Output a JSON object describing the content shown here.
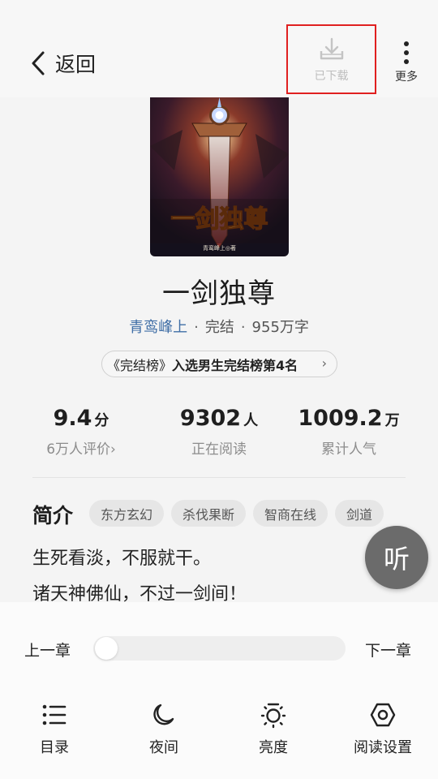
{
  "header": {
    "back_label": "返回",
    "download_label": "已下载",
    "more_label": "更多"
  },
  "book": {
    "cover_title": "一剑独尊",
    "cover_author": "青鸾峰上◎著",
    "title": "一剑独尊",
    "author": "青鸾峰上",
    "status": "完结",
    "word_count": "955万字",
    "rank_tag": "《完结榜》",
    "rank_text": "入选男生完结榜第4名",
    "rank_arrow": "›"
  },
  "stats": [
    {
      "value": "9.4",
      "unit": "分",
      "label": "6万人评价›"
    },
    {
      "value": "9302",
      "unit": "人",
      "label": "正在阅读"
    },
    {
      "value": "1009.2",
      "unit": "万",
      "label": "累计人气"
    }
  ],
  "intro": {
    "heading": "简介",
    "tags": [
      "东方玄幻",
      "杀伐果断",
      "智商在线",
      "剑道"
    ],
    "lines": [
      "生死看淡，不服就干。",
      "诸天神佛仙，不过一剑间！"
    ]
  },
  "listen_label": "听",
  "reader_panel": {
    "prev_chapter": "上一章",
    "next_chapter": "下一章",
    "progress": 0,
    "tools": [
      {
        "label": "目录",
        "icon": "list-icon"
      },
      {
        "label": "夜间",
        "icon": "moon-icon"
      },
      {
        "label": "亮度",
        "icon": "brightness-icon"
      },
      {
        "label": "阅读设置",
        "icon": "settings-hexagon-icon"
      }
    ]
  },
  "colors": {
    "highlight_border": "#e02020",
    "author_link": "#3f6ea6",
    "listen_button": "#6b6b6b"
  }
}
